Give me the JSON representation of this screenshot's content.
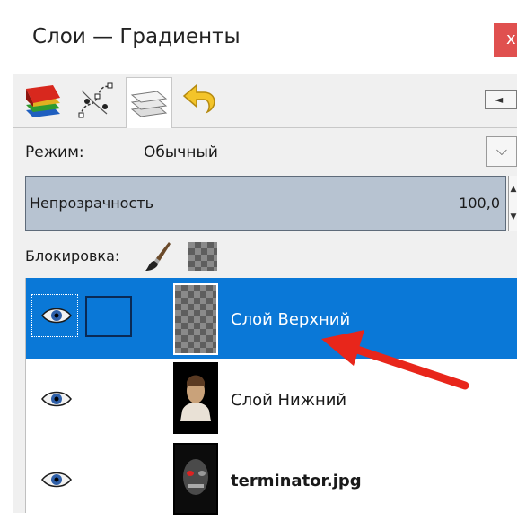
{
  "window": {
    "title": "Слои — Градиенты",
    "close_glyph": "x"
  },
  "tabs": [
    {
      "name": "layers-stack",
      "icon": "color-layers-icon"
    },
    {
      "name": "paths",
      "icon": "paths-icon"
    },
    {
      "name": "layers",
      "icon": "layers-icon",
      "active": true
    },
    {
      "name": "undo-history",
      "icon": "undo-icon"
    }
  ],
  "nav": {
    "arrow_glyph": "◄"
  },
  "mode": {
    "label": "Режим:",
    "value": "Обычный",
    "dropdown_glyph": "⌵"
  },
  "opacity": {
    "label": "Непрозрачность",
    "value": "100,0"
  },
  "spin": {
    "up": "▲",
    "down": "▼"
  },
  "lock": {
    "label": "Блокировка:"
  },
  "layers": [
    {
      "name": "Слой Верхний",
      "selected": true,
      "visible": true
    },
    {
      "name": "Слой Нижний",
      "selected": false,
      "visible": true
    },
    {
      "name": "terminator.jpg",
      "selected": false,
      "visible": true,
      "bold": true
    }
  ],
  "colors": {
    "selection": "#0a78d7",
    "opacity_bar": "#b7c3d1",
    "close": "#e0504f",
    "annotation_arrow": "#e8261b"
  }
}
